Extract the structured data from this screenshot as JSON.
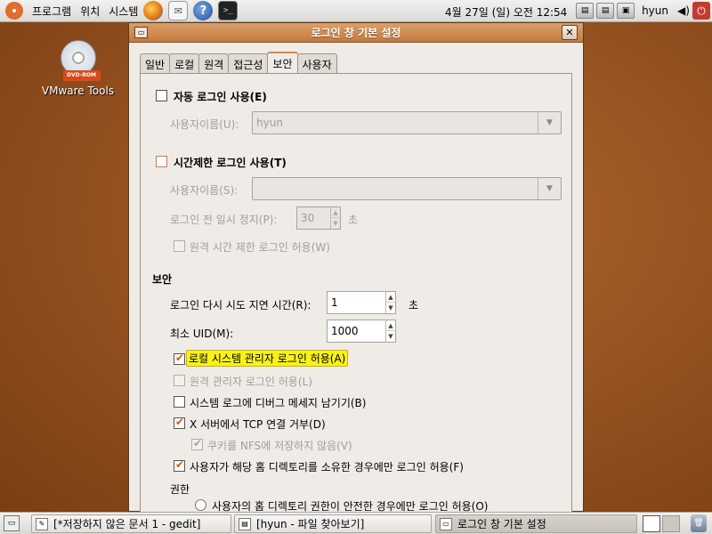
{
  "top_panel": {
    "menus": [
      "프로그램",
      "위치",
      "시스템"
    ],
    "clock": "4월 27일 (일) 오전 12:54",
    "user": "hyun"
  },
  "desktop": {
    "icon_label": "VMware Tools",
    "icon_badge": "DVD-ROM"
  },
  "window": {
    "title": "로그인 창 기본 설정",
    "tabs": [
      "일반",
      "로컬",
      "원격",
      "접근성",
      "보안",
      "사용자"
    ],
    "active_tab": "보안",
    "auto_login": {
      "label": "자동 로그인 사용(E)",
      "checked": false,
      "user_label": "사용자이름(U):",
      "user_value": "hyun"
    },
    "timed_login": {
      "label": "시간제한 로그인 사용(T)",
      "checked": false,
      "user_label": "사용자이름(S):",
      "user_value": "",
      "pause_label": "로그인 전 일시 정지(P):",
      "pause_value": "30",
      "pause_unit": "초",
      "remote_label": "원격 시간 제한 로그인 허용(W)"
    },
    "security": {
      "heading": "보안",
      "retry_label": "로그인 다시 시도 지연 시간(R):",
      "retry_value": "1",
      "retry_unit": "초",
      "uid_label": "최소 UID(M):",
      "uid_value": "1000",
      "local_admin_label": "로컬 시스템 관리자 로그인 허용(A)",
      "local_admin_checked": true,
      "remote_admin_label": "원격 관리자 로그인 허용(L)",
      "debug_label": "시스템 로그에 디버그 메세지 남기기(B)",
      "debug_checked": false,
      "tcp_label": "X 서버에서 TCP 연결 거부(D)",
      "tcp_checked": true,
      "nfs_label": "쿠키를 NFS에 저장하지 않음(V)",
      "nfs_checked": true,
      "owner_label": "사용자가 해당 홈 디렉토리를 소유한 경우에만 로그인 허용(F)",
      "owner_checked": true
    },
    "permissions": {
      "heading": "권한",
      "safe_label": "사용자의 홈 디렉토리 권한이 안전한 경우에만 로그인 허용(O)"
    }
  },
  "taskbar": {
    "tasks": [
      "[*저장하지 않은 문서 1 - gedit]",
      "[hyun - 파일 찾아보기]",
      "로그인 창 기본 설정"
    ],
    "active_index": 2
  },
  "colors": {
    "accent": "#d2541a",
    "titlebar": "#c98a50",
    "highlight": "#f8f21a",
    "desktop": "#93501f"
  }
}
